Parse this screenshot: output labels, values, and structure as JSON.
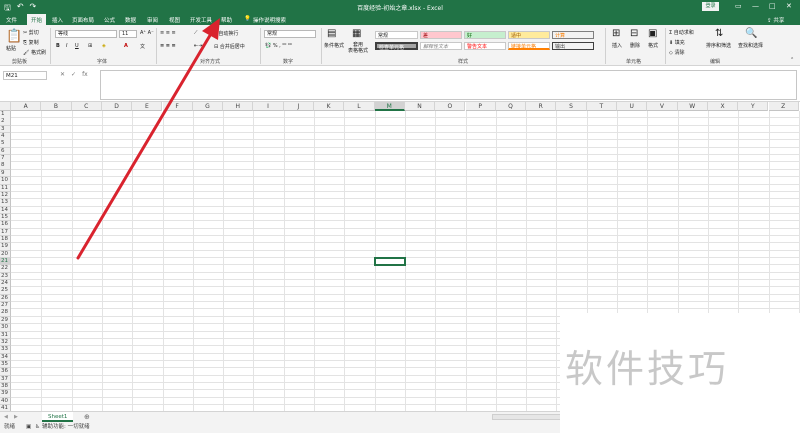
{
  "window": {
    "title": "百度经验-初始之章.xlsx  -  Excel",
    "login_label": "登录"
  },
  "tabs": [
    {
      "label": "文件"
    },
    {
      "label": "开始"
    },
    {
      "label": "插入"
    },
    {
      "label": "页面布局"
    },
    {
      "label": "公式"
    },
    {
      "label": "数据"
    },
    {
      "label": "审阅"
    },
    {
      "label": "视图"
    },
    {
      "label": "开发工具"
    },
    {
      "label": "帮助"
    },
    {
      "label": "操作说明搜索"
    }
  ],
  "share_label": "共享",
  "ribbon": {
    "clipboard": {
      "paste": "粘贴",
      "cut": "剪切",
      "copy": "复制",
      "format_painter": "格式刷",
      "group": "剪贴板"
    },
    "font": {
      "name": "等线",
      "size": "11",
      "group": "字体"
    },
    "alignment": {
      "wrap": "自动换行",
      "merge": "合并后居中",
      "group": "对齐方式"
    },
    "number": {
      "format": "常规",
      "group": "数字"
    },
    "styles": {
      "conditional": "条件格式",
      "table": "套用\n表格格式",
      "cells": [
        "常规",
        "差",
        "好",
        "适中",
        "计算",
        "检查单元格",
        "解释性文本",
        "警告文本",
        "链接单元格",
        "输出"
      ],
      "group": "样式"
    },
    "cells_group": {
      "insert": "插入",
      "delete": "删除",
      "format": "格式",
      "group": "单元格"
    },
    "editing": {
      "autosum": "自动求和",
      "fill": "填充",
      "clear": "清除",
      "sort": "排序和筛选",
      "find": "查找和选择",
      "group": "编辑"
    }
  },
  "formula_bar": {
    "name_box": "M21",
    "value": ""
  },
  "columns": [
    "A",
    "B",
    "C",
    "D",
    "E",
    "F",
    "G",
    "H",
    "I",
    "J",
    "K",
    "L",
    "M",
    "N",
    "O",
    "P",
    "Q",
    "R",
    "S",
    "T",
    "U",
    "V",
    "W",
    "X",
    "Y",
    "Z"
  ],
  "active_column": "M",
  "rows": [
    "1",
    "2",
    "3",
    "4",
    "5",
    "6",
    "7",
    "8",
    "9",
    "10",
    "11",
    "12",
    "13",
    "14",
    "15",
    "16",
    "17",
    "18",
    "19",
    "20",
    "21",
    "22",
    "23",
    "24",
    "25",
    "26",
    "27",
    "28",
    "29",
    "30",
    "31",
    "32",
    "33",
    "34",
    "35",
    "36",
    "37",
    "38",
    "39",
    "40",
    "41"
  ],
  "active_row": "21",
  "sheet": {
    "tab": "Sheet1"
  },
  "status": {
    "ready": "就绪",
    "accessibility": "辅助功能: 一切就绪"
  },
  "watermark": "软件技巧",
  "colors": {
    "brand": "#217346",
    "arrow": "#d9232e"
  }
}
